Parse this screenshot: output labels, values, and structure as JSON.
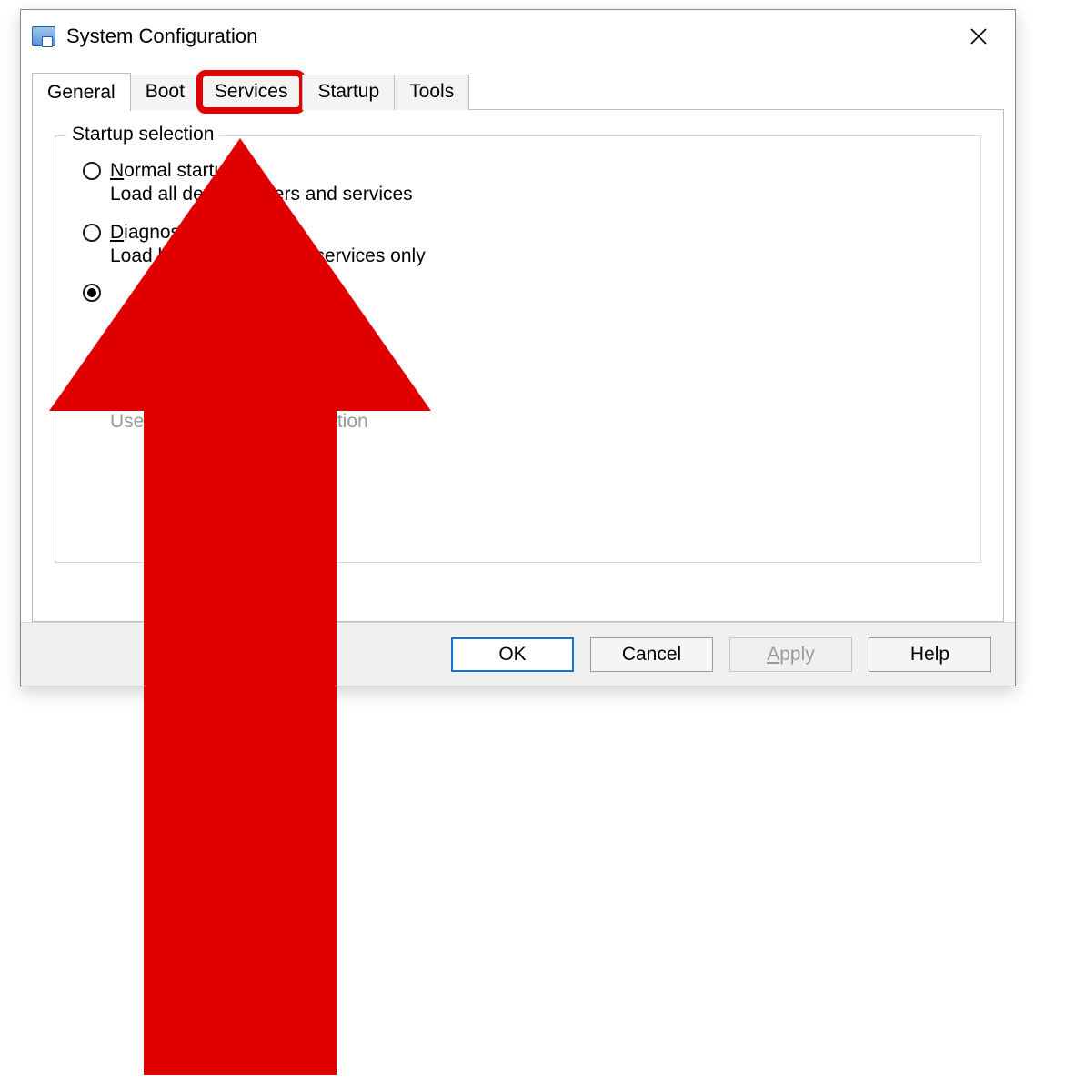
{
  "window": {
    "title": "System Configuration"
  },
  "tabs": {
    "general": "General",
    "boot": "Boot",
    "services": "Services",
    "startup": "Startup",
    "tools": "Tools"
  },
  "group": {
    "legend": "Startup selection"
  },
  "options": {
    "normal": {
      "label_prefix": "N",
      "label_rest": "ormal startup",
      "desc": "Load all device drivers and services"
    },
    "diagnostic": {
      "label_prefix": "D",
      "label_rest": "iagnostic startup",
      "desc": "Load basic devices and services only"
    },
    "boot_config": {
      "text": "Use original boot configuration"
    }
  },
  "buttons": {
    "ok": "OK",
    "cancel": "Cancel",
    "apply_prefix": "A",
    "apply_rest": "pply",
    "help": "Help"
  }
}
